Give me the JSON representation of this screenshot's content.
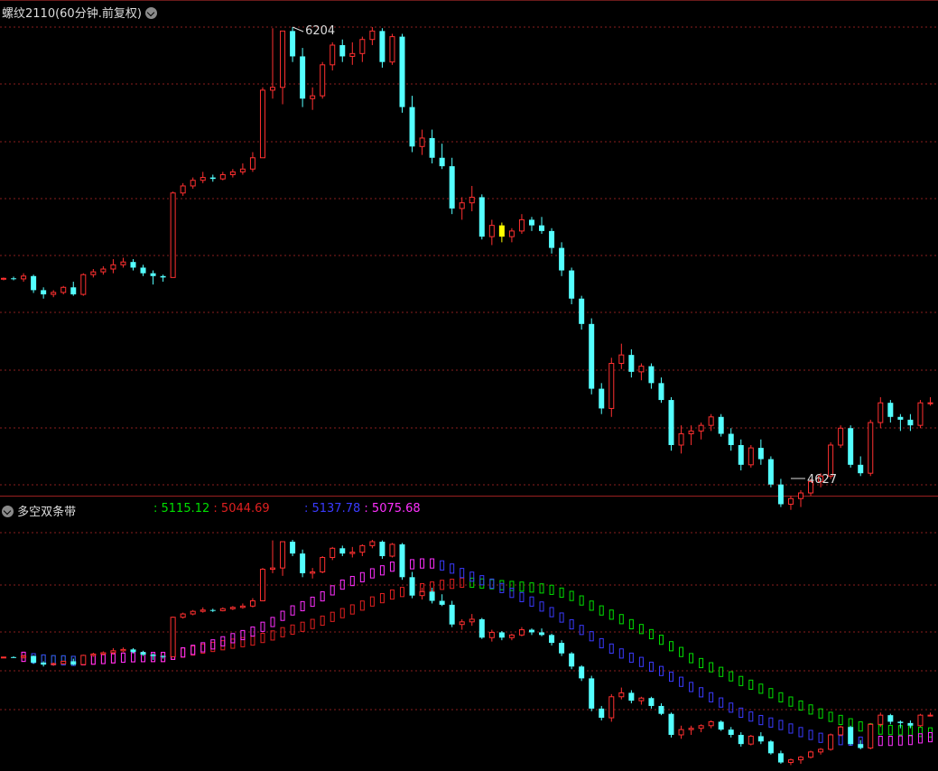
{
  "main_panel": {
    "title": "螺纹2110(60分钟.前复权)",
    "high_label": "6204",
    "low_label": "4627"
  },
  "sub_panel": {
    "title": "多空双条带",
    "values": [
      {
        "text": ": 5115.12",
        "color": "#00e000"
      },
      {
        "text": ": 5044.69",
        "color": "#e02020"
      },
      {
        "text": ": 5137.78",
        "color": "#3a3aff"
      },
      {
        "text": ": 5075.68",
        "color": "#ff30ff"
      }
    ]
  },
  "colors": {
    "background": "#000000",
    "up": "#ff3030",
    "down": "#54ffff",
    "grid": "#8a1e1e",
    "band_green": "#00e000",
    "band_blue": "#3a3aff",
    "band_magenta": "#ff30ff",
    "band_red": "#e02020",
    "highlight": "#ffff00"
  },
  "chart_data": {
    "type": "candlestick",
    "title": "螺纹2110(60分钟.前复权)",
    "period": "60分钟",
    "price_max": 6204,
    "price_min": 4627,
    "grid": true,
    "candles": [
      [
        5310,
        5315,
        5305,
        5312
      ],
      [
        5312,
        5318,
        5305,
        5310
      ],
      [
        5310,
        5330,
        5300,
        5320
      ],
      [
        5320,
        5325,
        5260,
        5270
      ],
      [
        5270,
        5280,
        5240,
        5255
      ],
      [
        5255,
        5270,
        5245,
        5262
      ],
      [
        5262,
        5285,
        5255,
        5280
      ],
      [
        5280,
        5300,
        5250,
        5255
      ],
      [
        5255,
        5330,
        5250,
        5325
      ],
      [
        5325,
        5345,
        5315,
        5335
      ],
      [
        5335,
        5355,
        5325,
        5345
      ],
      [
        5345,
        5380,
        5330,
        5360
      ],
      [
        5360,
        5385,
        5350,
        5370
      ],
      [
        5370,
        5380,
        5340,
        5350
      ],
      [
        5350,
        5360,
        5320,
        5330
      ],
      [
        5330,
        5340,
        5290,
        5320
      ],
      [
        5320,
        5325,
        5300,
        5315
      ],
      [
        5315,
        5620,
        5600,
        5615
      ],
      [
        5615,
        5650,
        5605,
        5640
      ],
      [
        5640,
        5670,
        5630,
        5660
      ],
      [
        5660,
        5690,
        5650,
        5670
      ],
      [
        5670,
        5680,
        5655,
        5665
      ],
      [
        5665,
        5690,
        5660,
        5680
      ],
      [
        5680,
        5700,
        5670,
        5690
      ],
      [
        5690,
        5720,
        5680,
        5700
      ],
      [
        5700,
        5760,
        5690,
        5740
      ],
      [
        5740,
        5990,
        5900,
        5980
      ],
      [
        5980,
        6200,
        5950,
        5990
      ],
      [
        5990,
        6190,
        5930,
        6190
      ],
      [
        6190,
        6204,
        6080,
        6100
      ],
      [
        6100,
        6130,
        5920,
        5950
      ],
      [
        5950,
        5990,
        5910,
        5960
      ],
      [
        5960,
        6080,
        5950,
        6070
      ],
      [
        6070,
        6150,
        6050,
        6140
      ],
      [
        6140,
        6160,
        6080,
        6100
      ],
      [
        6100,
        6150,
        6070,
        6110
      ],
      [
        6110,
        6170,
        6080,
        6160
      ],
      [
        6160,
        6204,
        6140,
        6190
      ],
      [
        6190,
        6200,
        6060,
        6080
      ],
      [
        6080,
        6180,
        6070,
        6170
      ],
      [
        6170,
        6180,
        5900,
        5920
      ],
      [
        5920,
        5960,
        5760,
        5780
      ],
      [
        5780,
        5840,
        5750,
        5810
      ],
      [
        5810,
        5840,
        5720,
        5740
      ],
      [
        5740,
        5790,
        5700,
        5710
      ],
      [
        5710,
        5740,
        5540,
        5560
      ],
      [
        5560,
        5600,
        5520,
        5580
      ],
      [
        5580,
        5640,
        5550,
        5600
      ],
      [
        5600,
        5610,
        5450,
        5460
      ],
      [
        5460,
        5520,
        5430,
        5500
      ],
      [
        5500,
        5510,
        5440,
        5460
      ],
      [
        5460,
        5490,
        5440,
        5480
      ],
      [
        5480,
        5540,
        5470,
        5520
      ],
      [
        5520,
        5530,
        5480,
        5500
      ],
      [
        5500,
        5530,
        5470,
        5480
      ],
      [
        5480,
        5490,
        5400,
        5420
      ],
      [
        5420,
        5440,
        5320,
        5340
      ],
      [
        5340,
        5350,
        5220,
        5240
      ],
      [
        5240,
        5250,
        5130,
        5150
      ],
      [
        5150,
        5170,
        4900,
        4920
      ],
      [
        4920,
        4940,
        4830,
        4850
      ],
      [
        4850,
        5030,
        4820,
        5010
      ],
      [
        5010,
        5080,
        4990,
        5040
      ],
      [
        5040,
        5060,
        4960,
        4980
      ],
      [
        4980,
        5010,
        4950,
        5000
      ],
      [
        5000,
        5010,
        4920,
        4940
      ],
      [
        4940,
        4960,
        4870,
        4880
      ],
      [
        4880,
        4890,
        4700,
        4720
      ],
      [
        4720,
        4790,
        4690,
        4760
      ],
      [
        4760,
        4790,
        4720,
        4770
      ],
      [
        4770,
        4800,
        4740,
        4790
      ],
      [
        4790,
        4830,
        4770,
        4820
      ],
      [
        4820,
        4830,
        4750,
        4760
      ],
      [
        4760,
        4780,
        4700,
        4720
      ],
      [
        4720,
        4740,
        4630,
        4650
      ],
      [
        4650,
        4720,
        4640,
        4710
      ],
      [
        4710,
        4740,
        4650,
        4670
      ],
      [
        4670,
        4680,
        4570,
        4580
      ],
      [
        4580,
        4600,
        4500,
        4510
      ],
      [
        4510,
        4540,
        4490,
        4530
      ],
      [
        4530,
        4560,
        4500,
        4550
      ],
      [
        4550,
        4600,
        4540,
        4590
      ],
      [
        4590,
        4620,
        4570,
        4610
      ],
      [
        4610,
        4730,
        4600,
        4720
      ],
      [
        4720,
        4790,
        4710,
        4780
      ],
      [
        4780,
        4790,
        4640,
        4650
      ],
      [
        4650,
        4680,
        4610,
        4620
      ],
      [
        4620,
        4810,
        4610,
        4800
      ],
      [
        4800,
        4890,
        4780,
        4870
      ],
      [
        4870,
        4880,
        4800,
        4820
      ],
      [
        4820,
        4830,
        4770,
        4810
      ],
      [
        4810,
        4830,
        4770,
        4790
      ],
      [
        4790,
        4880,
        4780,
        4870
      ],
      [
        4870,
        4890,
        4860,
        4870
      ]
    ],
    "highlighted_candles": [
      50
    ],
    "sub_chart": {
      "title": "多空双条带",
      "legend_values": [
        "5115.12",
        "5044.69",
        "5137.78",
        "5075.68"
      ]
    }
  }
}
